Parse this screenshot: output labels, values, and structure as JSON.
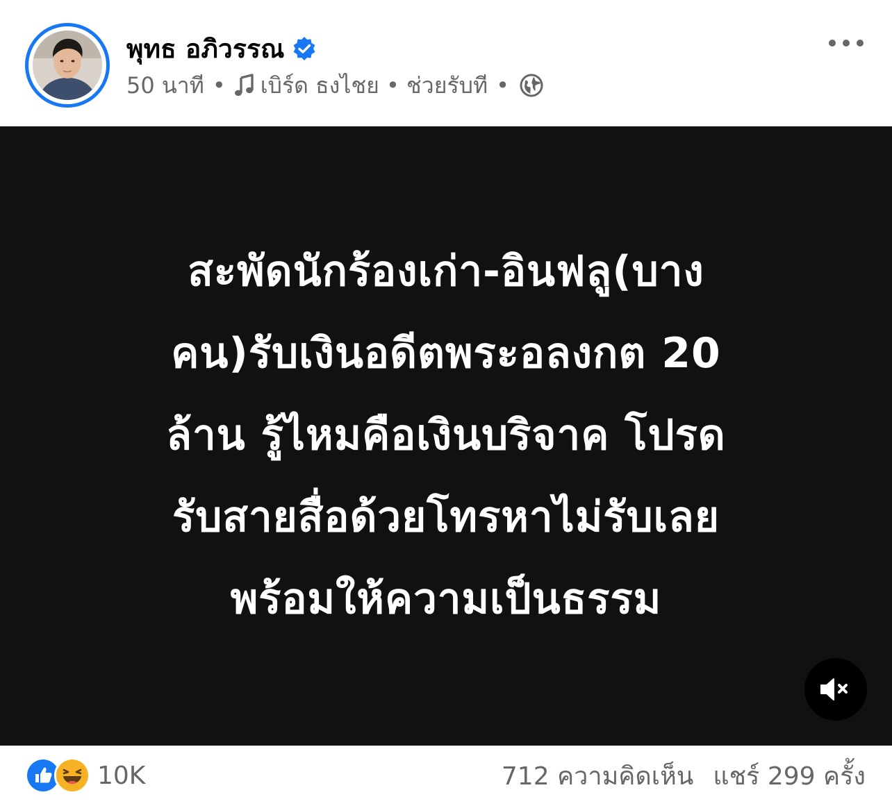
{
  "author": {
    "name": "พุทธ อภิวรรณ",
    "verified": true
  },
  "meta": {
    "time": "50 นาที",
    "separator": "•",
    "music": "เบิร์ด ธงไชย • ช่วยรับที",
    "audience_icon": "globe-icon"
  },
  "media": {
    "headline_lines": [
      "สะพัดนักร้องเก่า-อินฟลู(บาง",
      "คน)รับเงินอดีตพระอลงกต 20",
      "ล้าน รู้ไหมคือเงินบริจาค โปรด",
      "รับสายสื่อด้วยโทรหาไม่รับเลย",
      "พร้อมให้ความเป็นธรรม"
    ],
    "background_color": "#111111",
    "mute_icon": "speaker-muted-icon"
  },
  "footer": {
    "reaction_count": "10K",
    "reactions": [
      "like",
      "haha"
    ],
    "comments": "712 ความคิดเห็น",
    "shares": "แชร์ 299 ครั้ง"
  },
  "colors": {
    "accent": "#1877f2",
    "secondary_text": "#65676b",
    "haha": "#f7b125"
  }
}
